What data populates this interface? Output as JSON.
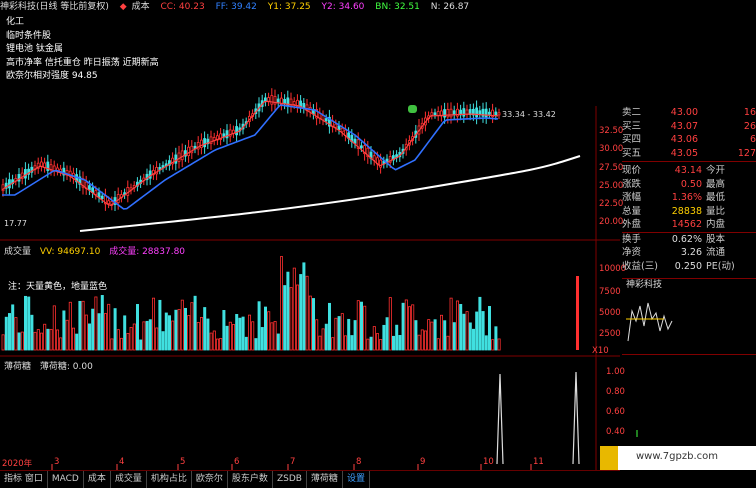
{
  "topbar": {
    "title": "神彩科技(日线 等比前复权)",
    "cost_arrow": "◆",
    "cost_label": "成本",
    "cc": "CC: 40.23",
    "ff": "FF: 39.42",
    "y1": "Y1: 37.25",
    "y2": "Y2: 34.60",
    "bn": "BN: 32.51",
    "n": "N: 26.87"
  },
  "tags": [
    "化工",
    "临时条件股",
    "锂电池 钛金属",
    "高市净率 信托重仓 昨日振荡 近期新高",
    "欧奈尔相对强度 94.85"
  ],
  "price_axis": [
    "32.50",
    "30.00",
    "27.50",
    "25.00",
    "22.50",
    "20.00"
  ],
  "price_marker": "33.34 - 33.42",
  "low_marker": "17.77",
  "volume_header": {
    "name": "成交量",
    "vv": "VV: 94697.10",
    "cjl": "成交量: 28837.80"
  },
  "volume_note": "注：天量黄色，地量蓝色",
  "volume_axis": [
    "10000",
    "7500",
    "5000",
    "2500"
  ],
  "volume_unit": "X10",
  "mint_header": {
    "name": "薄荷糖",
    "val": "薄荷糖: 0.00"
  },
  "mint_axis": [
    "1.00",
    "0.80",
    "0.60",
    "0.40"
  ],
  "quote": {
    "asks": [
      {
        "label": "卖二",
        "price": "43.00",
        "qty": "16"
      },
      {
        "label": "买三",
        "price": "43.07",
        "qty": "26"
      },
      {
        "label": "买四",
        "price": "43.06",
        "qty": "6"
      },
      {
        "label": "买五",
        "price": "43.05",
        "qty": "127"
      }
    ],
    "info": [
      {
        "l": "现价",
        "v": "43.14",
        "l2": "今开"
      },
      {
        "l": "涨跌",
        "v": "0.50",
        "l2": "最高"
      },
      {
        "l": "涨幅",
        "v": "1.36%",
        "l2": "最低"
      },
      {
        "l": "总量",
        "v": "28838",
        "l2": "量比"
      },
      {
        "l": "外盘",
        "v": "14562",
        "l2": "内盘"
      },
      {
        "l": "换手",
        "v": "0.62%",
        "l2": "股本"
      },
      {
        "l": "净资",
        "v": "3.26",
        "l2": "流通"
      },
      {
        "l": "收益(三)",
        "v": "0.250",
        "l2": "PE(动)"
      }
    ],
    "mini_title": "神彩科技"
  },
  "x_axis": [
    "2020年",
    "3",
    "4",
    "5",
    "6",
    "7",
    "8",
    "9",
    "10",
    "11"
  ],
  "tabs": [
    "指标 窗口",
    "MACD",
    "成本",
    "成交量",
    "机构占比",
    "欧奈尔",
    "股东户数",
    "ZSDB",
    "薄荷糖",
    "设置"
  ],
  "watermark": "www.7gpzb.com",
  "colors": {
    "up": "#ff3030",
    "down": "#40e0e0",
    "ma_red": "#ff4040",
    "ma_blue": "#3070ff",
    "white": "#ffffff"
  }
}
